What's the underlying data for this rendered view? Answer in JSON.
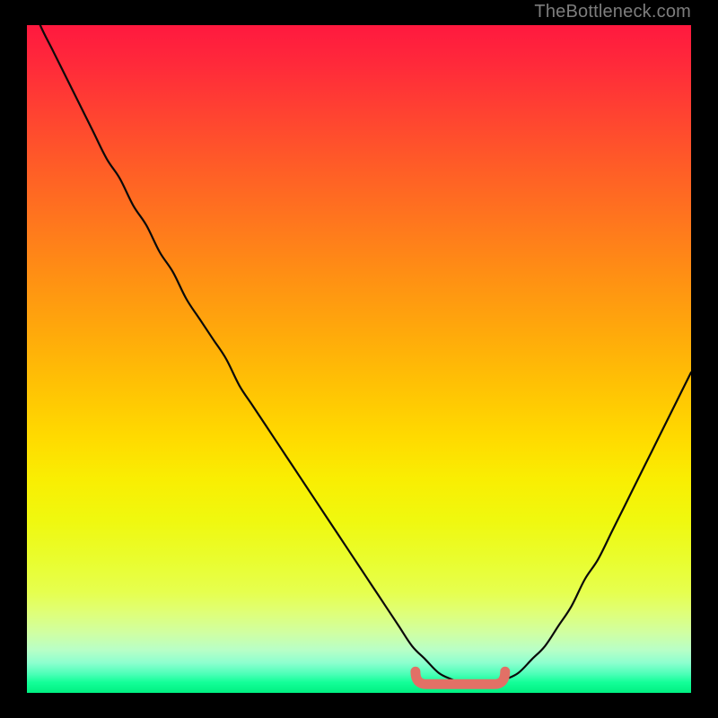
{
  "watermark": "TheBottleneck.com",
  "colors": {
    "frame": "#000000",
    "curve_stroke": "#0a0a0a",
    "bottom_marker": "#e27066",
    "gradient_top": "#ff193f",
    "gradient_bottom": "#00f081"
  },
  "chart_data": {
    "type": "line",
    "title": "",
    "xlabel": "",
    "ylabel": "",
    "xlim": [
      0,
      100
    ],
    "ylim": [
      0,
      100
    ],
    "grid": false,
    "legend": false,
    "series": [
      {
        "name": "bottleneck-curve",
        "x": [
          0,
          2,
          4,
          6,
          8,
          10,
          12,
          14,
          16,
          18,
          20,
          22,
          24,
          26,
          28,
          30,
          32,
          34,
          36,
          38,
          40,
          42,
          44,
          46,
          48,
          50,
          52,
          54,
          56,
          58,
          60,
          62,
          64,
          66,
          68,
          70,
          72,
          74,
          76,
          78,
          80,
          82,
          84,
          86,
          88,
          90,
          92,
          94,
          96,
          98,
          100
        ],
        "y": [
          105,
          100,
          96,
          92,
          88,
          84,
          80,
          77,
          73,
          70,
          66,
          63,
          59,
          56,
          53,
          50,
          46,
          43,
          40,
          37,
          34,
          31,
          28,
          25,
          22,
          19,
          16,
          13,
          10,
          7,
          5,
          3,
          2,
          1.2,
          1,
          1.2,
          2,
          3,
          5,
          7,
          10,
          13,
          17,
          20,
          24,
          28,
          32,
          36,
          40,
          44,
          48
        ]
      }
    ],
    "annotations": [
      {
        "name": "valley-marker",
        "x_range": [
          58.5,
          72
        ],
        "y": 1.3,
        "style": "thick-pink-underline"
      }
    ]
  }
}
